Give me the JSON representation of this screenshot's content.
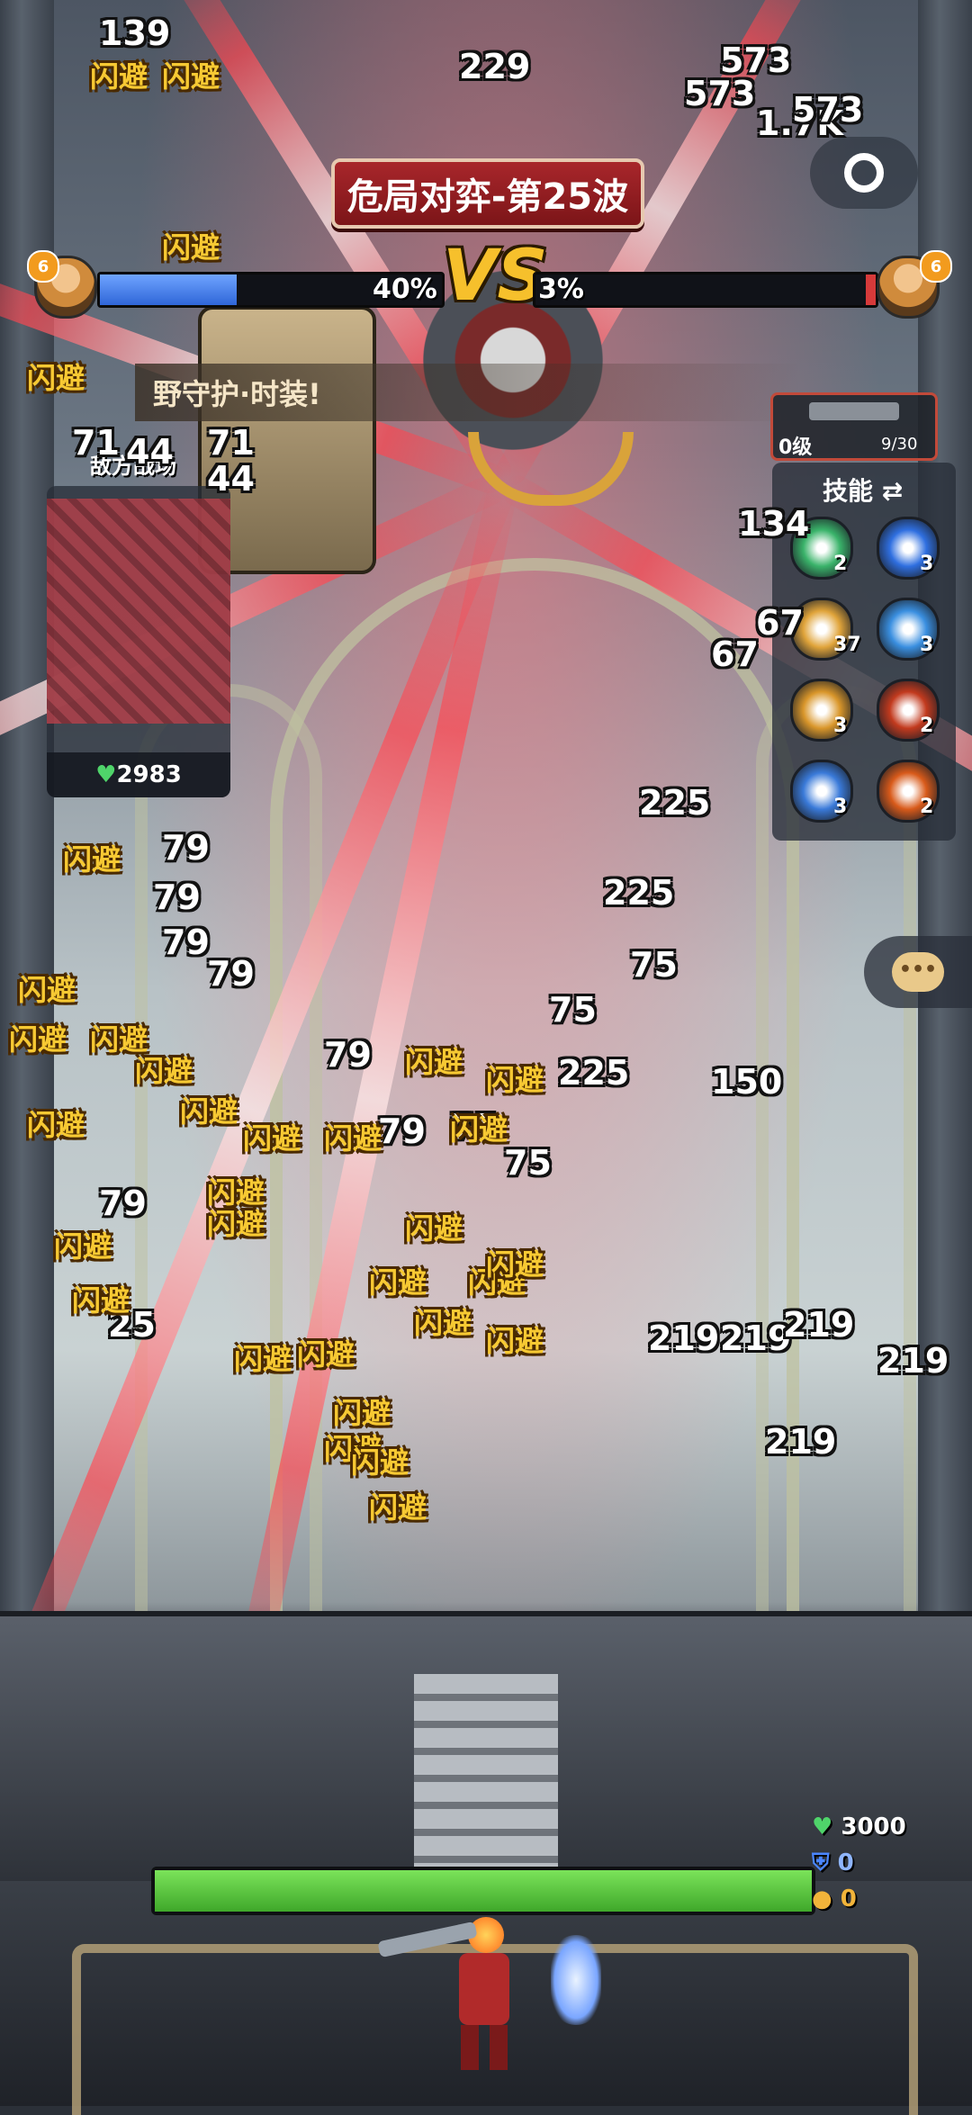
{
  "hud": {
    "wave_title": "危局对弈-第25波",
    "player_level": "6",
    "enemy_level": "6",
    "player_hp_percent_label": "40%",
    "player_hp_fraction": 0.4,
    "enemy_hp_percent_label": "3%",
    "enemy_hp_fraction": 0.03,
    "vs_label": "VS"
  },
  "announcement": "野守护·时装!",
  "left_panel": {
    "title": "敌方战场",
    "hp": "2983"
  },
  "weapon": {
    "level": "0级",
    "progress": "9/30",
    "progress_fraction": 0.3
  },
  "skills_panel": {
    "title": "技能 ⇄",
    "skills": [
      {
        "icon": "green-whirlwind-icon",
        "count": "2",
        "color": "#3ab36a"
      },
      {
        "icon": "blue-lightning-icon",
        "count": "3",
        "color": "#2f6fe0"
      },
      {
        "icon": "gold-gear-icon",
        "count": "37",
        "color": "#e0a43a"
      },
      {
        "icon": "blue-tower-icon",
        "count": "3",
        "color": "#3a8fe0"
      },
      {
        "icon": "gold-robot-icon",
        "count": "3",
        "color": "#d9962a"
      },
      {
        "icon": "red-fire-wheel-icon",
        "count": "2",
        "color": "#c23a1e"
      },
      {
        "icon": "blue-storm-icon",
        "count": "3",
        "color": "#3a7ad9"
      },
      {
        "icon": "orange-flame-icon",
        "count": "2",
        "color": "#d85a1a"
      }
    ]
  },
  "player_stats": {
    "hp": "3000",
    "shield": "0",
    "coins": "0",
    "base_hp_fraction": 1.0
  },
  "damage_numbers": [
    "573",
    "229",
    "1.7K",
    "573",
    "573",
    "225",
    "225",
    "75",
    "75",
    "225",
    "150",
    "79",
    "79",
    "79",
    "79",
    "79",
    "79",
    "79",
    "75",
    "75",
    "219",
    "219",
    "219",
    "219",
    "219",
    "25",
    "134",
    "67",
    "67",
    "71",
    "44",
    "71",
    "44",
    "139"
  ],
  "dodge_label": "闪避"
}
